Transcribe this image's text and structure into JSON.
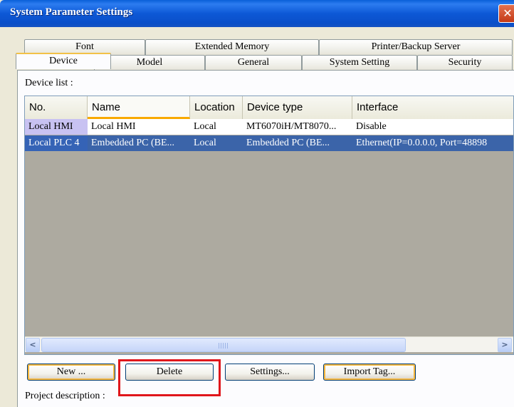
{
  "window": {
    "title": "System Parameter Settings",
    "close_glyph": "✕"
  },
  "tabs_row1": [
    "Font",
    "Extended Memory",
    "Printer/Backup Server"
  ],
  "tabs_row2": [
    "Device",
    "Model",
    "General",
    "System Setting",
    "Security"
  ],
  "active_tab": "Device",
  "device_list": {
    "label": "Device list :",
    "columns": [
      "No.",
      "Name",
      "Location",
      "Device type",
      "Interface"
    ],
    "rows": [
      [
        "Local HMI",
        "Local HMI",
        "Local",
        "MT6070iH/MT8070...",
        "Disable"
      ],
      [
        "Local PLC 4",
        "Embedded PC (BE...",
        "Local",
        "Embedded PC (BE...",
        "Ethernet(IP=0.0.0.0, Port=48898"
      ]
    ],
    "selected_row": 1
  },
  "scrollbar": {
    "left_arrow_icon": "chevron-left-icon",
    "right_arrow_icon": "chevron-right-icon"
  },
  "buttons": {
    "new": "New ...",
    "delete": "Delete",
    "settings": "Settings...",
    "import_tag": "Import Tag..."
  },
  "project_description_label": "Project description :",
  "colors": {
    "title_bar": "#0A4FC9",
    "selection": "#3B64A9",
    "highlight_box": "#E0161B"
  }
}
